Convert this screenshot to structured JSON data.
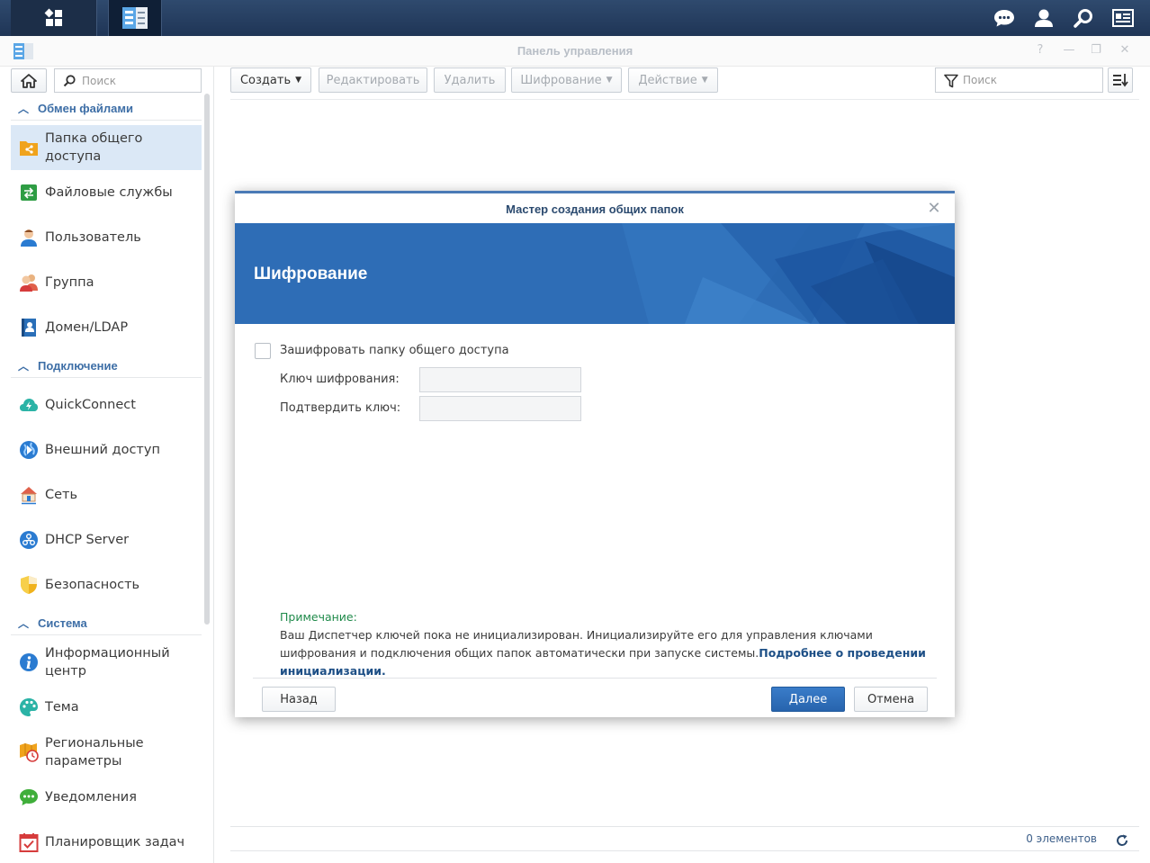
{
  "window": {
    "title": "Панель управления",
    "controls": [
      "?",
      "—",
      "❐",
      "✕"
    ]
  },
  "sidebar": {
    "search_placeholder": "Поиск",
    "sections": [
      {
        "label": "Обмен файлами"
      },
      {
        "label": "Подключение"
      },
      {
        "label": "Система"
      }
    ],
    "items": [
      {
        "label": "Папка общего доступа",
        "icon": "shared-folder-icon",
        "color": "#f0a31c"
      },
      {
        "label": "Файловые службы",
        "icon": "file-services-icon",
        "color": "#2e9d44"
      },
      {
        "label": "Пользователь",
        "icon": "user-icon",
        "color": "#d7773a"
      },
      {
        "label": "Группа",
        "icon": "group-icon",
        "color": "#d7773a"
      },
      {
        "label": "Домен/LDAP",
        "icon": "domain-ldap-icon",
        "color": "#2a6fb8"
      },
      {
        "label": "QuickConnect",
        "icon": "quickconnect-icon",
        "color": "#2bb3a6"
      },
      {
        "label": "Внешний доступ",
        "icon": "external-access-icon",
        "color": "#2a7bd1"
      },
      {
        "label": "Сеть",
        "icon": "network-icon",
        "color": "#e0604a"
      },
      {
        "label": "DHCP Server",
        "icon": "dhcp-server-icon",
        "color": "#2a7bd1"
      },
      {
        "label": "Безопасность",
        "icon": "security-shield-icon",
        "color": "#f0b21c"
      },
      {
        "label": "Информационный центр",
        "icon": "info-center-icon",
        "color": "#2a7bd1"
      },
      {
        "label": "Тема",
        "icon": "theme-palette-icon",
        "color": "#2bb3a6"
      },
      {
        "label": "Региональные параметры",
        "icon": "regional-options-icon",
        "color": "#f0a31c"
      },
      {
        "label": "Уведомления",
        "icon": "notifications-icon",
        "color": "#3fae3a"
      },
      {
        "label": "Планировщик задач",
        "icon": "task-scheduler-icon",
        "color": "#d63c3c"
      }
    ]
  },
  "toolbar": {
    "create": "Создать",
    "edit": "Редактировать",
    "delete": "Удалить",
    "encryption": "Шифрование",
    "action": "Действие",
    "filter_placeholder": "Поиск"
  },
  "footer": {
    "count": "0 элементов"
  },
  "wizard": {
    "title": "Мастер создания общих папок",
    "step_title": "Шифрование",
    "encrypt_checkbox_label": "Зашифровать папку общего доступа",
    "encrypt_checked": false,
    "key_label": "Ключ шифрования:",
    "key_value": "",
    "confirm_label": "Подтвердить ключ:",
    "confirm_value": "",
    "note_heading": "Примечание:",
    "note_text": "Ваш Диспетчер ключей пока не инициализирован. Инициализируйте его для управления ключами шифрования и подключения общих папок автоматически при запуске системы.",
    "note_link": "Подробнее о проведении инициализации.",
    "back_button": "Назад",
    "next_button": "Далее",
    "cancel_button": "Отмена"
  }
}
